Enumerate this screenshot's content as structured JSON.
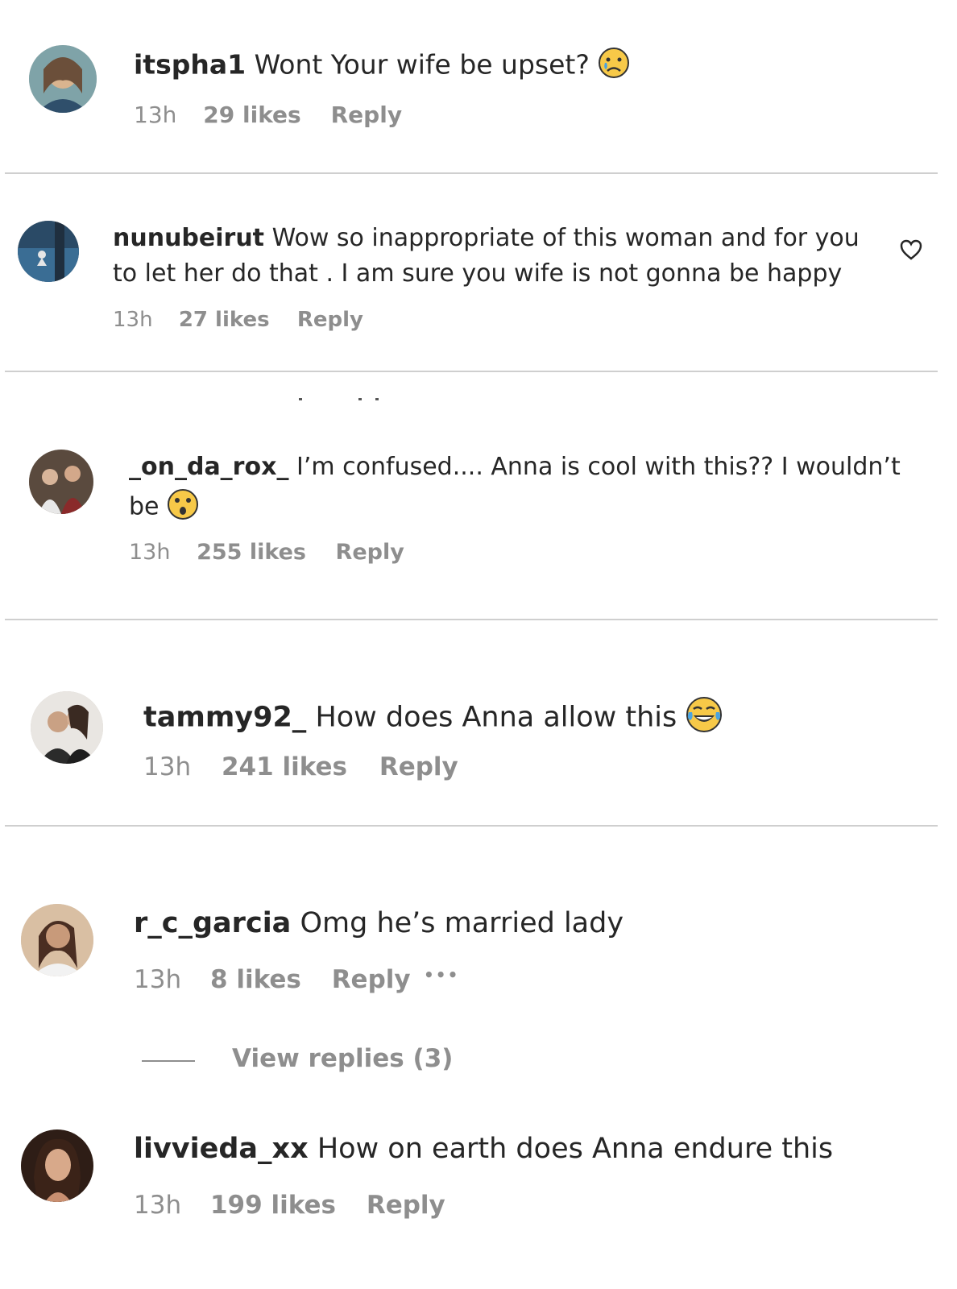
{
  "comments": [
    {
      "username": "itspha1",
      "text": "Wont Your wife be upset?",
      "emoji": "crying-face",
      "time": "13h",
      "likes": "29 likes",
      "reply": "Reply"
    },
    {
      "username": "nunubeirut",
      "text_line1": "Wow so inappropriate of this woman and for you",
      "text_line2": "to let her do that . I am sure you wife is not gonna be happy",
      "time": "13h",
      "likes": "27 likes",
      "reply": "Reply",
      "like_icon": "heart-outline-icon"
    },
    {
      "username": "_on_da_rox_",
      "text_line1": "I’m confused.... Anna is cool with this?? I wouldn’t",
      "text_line2": "be",
      "emoji": "astonished-face",
      "time": "13h",
      "likes": "255 likes",
      "reply": "Reply"
    },
    {
      "username": "tammy92_",
      "text": "How does Anna allow this",
      "emoji": "tears-of-joy-face",
      "time": "13h",
      "likes": "241 likes",
      "reply": "Reply"
    },
    {
      "username": "r_c_garcia",
      "text": "Omg he’s married lady",
      "time": "13h",
      "likes": "8 likes",
      "reply": "Reply",
      "more": "•••",
      "view_replies": "View replies (3)"
    },
    {
      "username": "livvieda_xx",
      "text": "How on earth does Anna endure this",
      "time": "13h",
      "likes": "199 likes",
      "reply": "Reply"
    }
  ],
  "colors": {
    "text": "#262626",
    "secondary": "#8e8e8e",
    "divider": "#cfcfcf",
    "emoji": "#f7c948"
  }
}
